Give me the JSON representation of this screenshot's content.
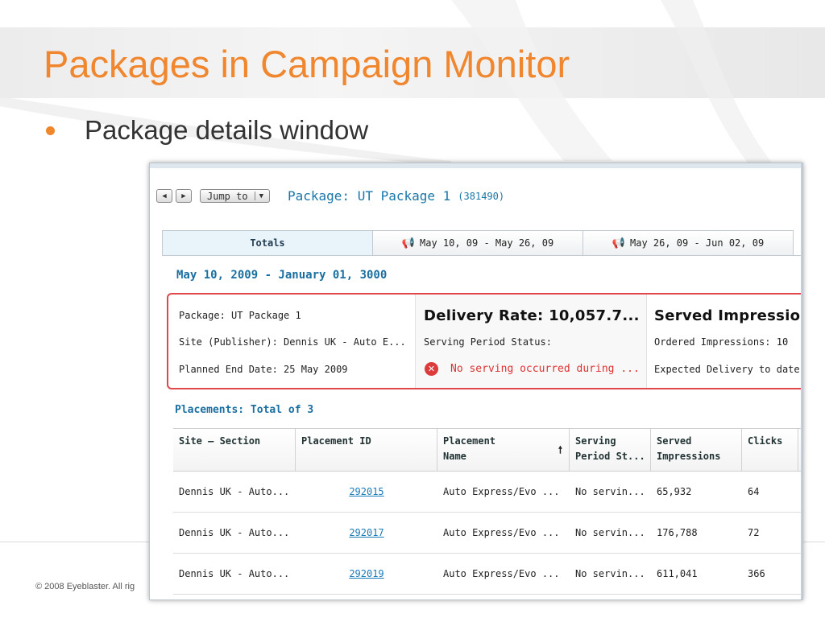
{
  "slide": {
    "title": "Packages in Campaign Monitor",
    "bullet": "Package details window",
    "footer": "© 2008 Eyeblaster. All rig",
    "accent_color": "#f0862d"
  },
  "window": {
    "nav_back_icon": "triangle-left-icon",
    "nav_forward_icon": "triangle-right-icon",
    "jump_to_label": "Jump to",
    "jump_to_arrow": "▼",
    "package_title": "Package: UT Package 1",
    "package_id": "(381490)",
    "tabs": [
      {
        "label": "Totals",
        "icon": ""
      },
      {
        "label": "May 10, 09 - May 26, 09",
        "icon": "megaphone-icon"
      },
      {
        "label": "May 26, 09 - Jun 02, 09",
        "icon": "megaphone-icon"
      }
    ],
    "date_range": "May 10, 2009 - January 01, 3000",
    "summary": {
      "package": "Package: UT Package 1",
      "site": "Site (Publisher): Dennis UK - Auto E...",
      "planned_end": "Planned End Date: 25 May 2009",
      "delivery_rate": "Delivery Rate: 10,057.7...",
      "serving_status_label": "Serving Period Status:",
      "serving_status_value": "No serving occurred during ...",
      "served_impressions": "Served Impressio",
      "ordered_impressions": "Ordered Impressions: 10",
      "expected_delivery": "Expected Delivery to date"
    },
    "placements_title": "Placements: Total of  3",
    "grid": {
      "headers": [
        "Site – Section",
        "Placement ID",
        "Placement Name",
        "Serving Period St...",
        "Served Impressions",
        "Clicks"
      ],
      "rows": [
        [
          "Dennis UK - Auto...",
          "292015",
          "Auto Express/Evo ...",
          "No servin...",
          "65,932",
          "64"
        ],
        [
          "Dennis UK - Auto...",
          "292017",
          "Auto Express/Evo ...",
          "No servin...",
          "176,788",
          "72"
        ],
        [
          "Dennis UK - Auto...",
          "292019",
          "Auto Express/Evo ...",
          "No servin...",
          "611,041",
          "366"
        ]
      ]
    }
  }
}
